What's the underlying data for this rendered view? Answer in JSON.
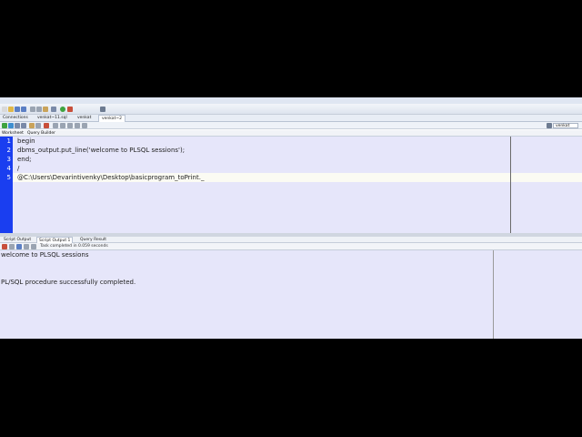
{
  "menu": [],
  "doc_tabs": [
    {
      "label": "Connections"
    },
    {
      "label": "venkat~11.sql"
    },
    {
      "label": "venkat"
    },
    {
      "label": "venkat~2"
    }
  ],
  "connection_selector": "venkat",
  "worksheet_tabs": [
    {
      "label": "Worksheet"
    },
    {
      "label": "Query Builder"
    }
  ],
  "editor": {
    "lines": [
      {
        "num": "1",
        "text": "begin"
      },
      {
        "num": "2",
        "text": "dbms_output.put_line('welcome to PLSQL sessions');"
      },
      {
        "num": "3",
        "text": "end;"
      },
      {
        "num": "4",
        "text": "/"
      },
      {
        "num": "5",
        "text": "@C:\\Users\\Devarintivenky\\Desktop\\basicprogram_toPrint._"
      }
    ],
    "current_line": 5
  },
  "output_tabs": [
    {
      "label": "Script Output"
    },
    {
      "label": "Script Output 1"
    },
    {
      "label": "Query Result"
    }
  ],
  "status_text": "Task completed in 0.059 seconds",
  "output_lines": [
    "welcome to PLSQL sessions",
    "",
    "",
    "PL/SQL procedure successfully completed."
  ],
  "colors": {
    "gutter": "#1a3ef0",
    "editor_bg": "#e6e6fa",
    "current_line_bg": "#fbfbf3"
  }
}
